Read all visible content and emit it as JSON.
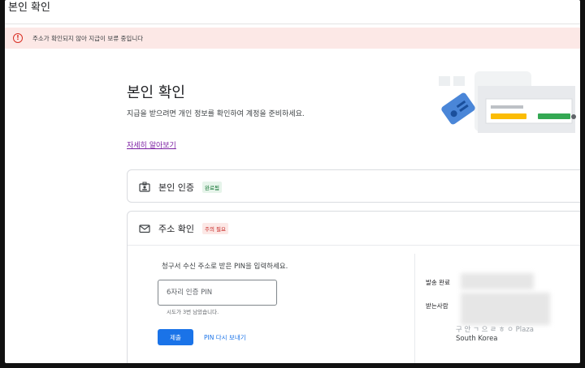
{
  "window": {
    "title": "본인 확인"
  },
  "alert": {
    "text": "주소가 확인되지 않아 지급이 보류 중입니다",
    "color": "#d93025",
    "background": "#fce8e6"
  },
  "header": {
    "title": "본인 확인",
    "description": "지급을 받으려면 개인 정보를 확인하여 계정을 준비하세요.",
    "learn_more": "자세히 알아보기"
  },
  "identity_card": {
    "label": "본인 인증",
    "badge": "완료됨",
    "icon": "id-card-icon"
  },
  "address_card": {
    "label": "주소 확인",
    "badge": "주의 필요",
    "icon": "mail-icon",
    "instruction": "청구서 수신 주소로 받은 PIN을 입력하세요.",
    "pin_placeholder": "6자리 인증 PIN",
    "pin_value": "",
    "attempts": "시도가 3번 남았습니다.",
    "submit_label": "제출",
    "resend_label": "PIN 다시 보내기",
    "ship_status_label": "발송 완료",
    "recipient_label": "받는사람",
    "address_partial": "구 안 ㄱ 으 ㄹ ㅎ ㅇ Plaza",
    "address_country": "South Korea"
  },
  "colors": {
    "accent": "#1a73e8",
    "success": "#137333",
    "danger": "#c5221f",
    "link": "#7b1fa2"
  }
}
